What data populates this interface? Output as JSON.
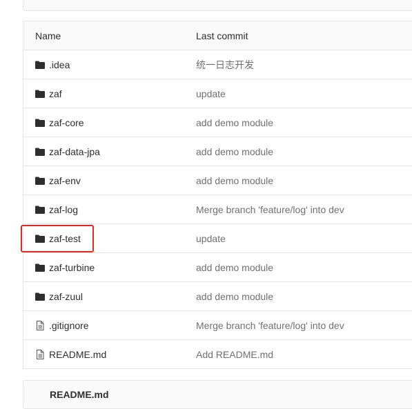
{
  "table": {
    "header": {
      "name": "Name",
      "last_commit": "Last commit"
    },
    "rows": [
      {
        "name": ".idea",
        "commit": "统一日志开发",
        "type": "folder"
      },
      {
        "name": "zaf",
        "commit": "update",
        "type": "folder"
      },
      {
        "name": "zaf-core",
        "commit": "add demo module",
        "type": "folder"
      },
      {
        "name": "zaf-data-jpa",
        "commit": "add demo module",
        "type": "folder"
      },
      {
        "name": "zaf-env",
        "commit": "add demo module",
        "type": "folder"
      },
      {
        "name": "zaf-log",
        "commit": "Merge branch 'feature/log' into dev",
        "type": "folder"
      },
      {
        "name": "zaf-test",
        "commit": "update",
        "type": "folder"
      },
      {
        "name": "zaf-turbine",
        "commit": "add demo module",
        "type": "folder"
      },
      {
        "name": "zaf-zuul",
        "commit": "add demo module",
        "type": "folder"
      },
      {
        "name": ".gitignore",
        "commit": "Merge branch 'feature/log' into dev",
        "type": "file"
      },
      {
        "name": "README.md",
        "commit": "Add README.md",
        "type": "file"
      }
    ]
  },
  "readme": {
    "title": "README.md"
  },
  "colors": {
    "highlight": "#e0281e",
    "border": "#e5e5e5"
  }
}
